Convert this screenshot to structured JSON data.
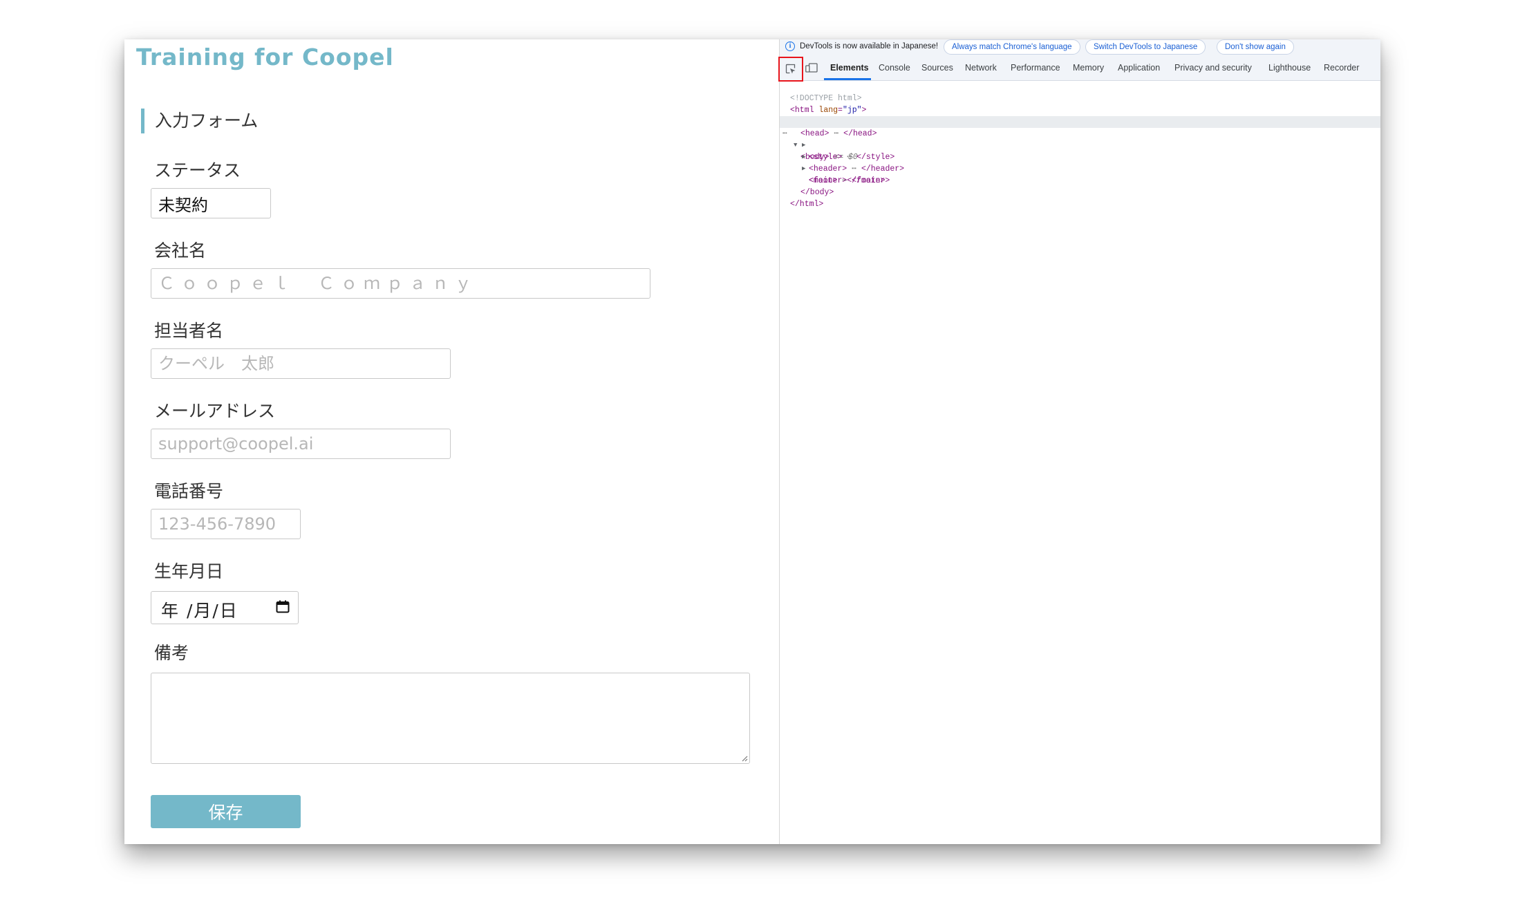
{
  "page": {
    "app_title": "Training for Coopel",
    "section_title": "入力フォーム",
    "form": {
      "status_label": "ステータス",
      "status_value": "未契約",
      "company_label": "会社名",
      "company_placeholder": "Ｃｏｏｐｅｌ　Ｃｏｍｐａｎｙ",
      "contact_label": "担当者名",
      "contact_placeholder": "クーペル　太郎",
      "email_label": "メールアドレス",
      "email_placeholder": "support@coopel.ai",
      "phone_label": "電話番号",
      "phone_placeholder": "123-456-7890",
      "birthday_label": "生年月日",
      "birthday_value": "年 /月/日",
      "notes_label": "備考",
      "notes_value": "",
      "save_label": "保存"
    },
    "accent_color": "#74b8c9"
  },
  "devtools": {
    "infobar": {
      "message": "DevTools is now available in Japanese!",
      "btn_match": "Always match Chrome's language",
      "btn_switch": "Switch DevTools to Japanese",
      "btn_dismiss": "Don't show again"
    },
    "tools": {
      "inspect_icon": "inspect-element-icon",
      "device_icon": "device-toolbar-icon"
    },
    "tabs": [
      "Elements",
      "Console",
      "Sources",
      "Network",
      "Performance",
      "Memory",
      "Application",
      "Privacy and security",
      "Lighthouse",
      "Recorder"
    ],
    "active_tab": "Elements",
    "dom": {
      "doctype": "<!DOCTYPE html>",
      "html_open": "<html",
      "lang_attr": "lang",
      "lang_value": "\"jp\"",
      "gt": ">",
      "head_open": "<head>",
      "ellipsis": "⋯",
      "head_close": "</head>",
      "body_open": "<body>",
      "body_marker": "== $0",
      "row_dots": "⋯",
      "style_open": "<style>",
      "style_close": "</style>",
      "header_open": "<header>",
      "header_close": "</header>",
      "main_open": "<main>",
      "main_close": "</main>",
      "footer_line": "<footer></footer>",
      "body_close": "</body>",
      "html_close": "</html>"
    }
  }
}
